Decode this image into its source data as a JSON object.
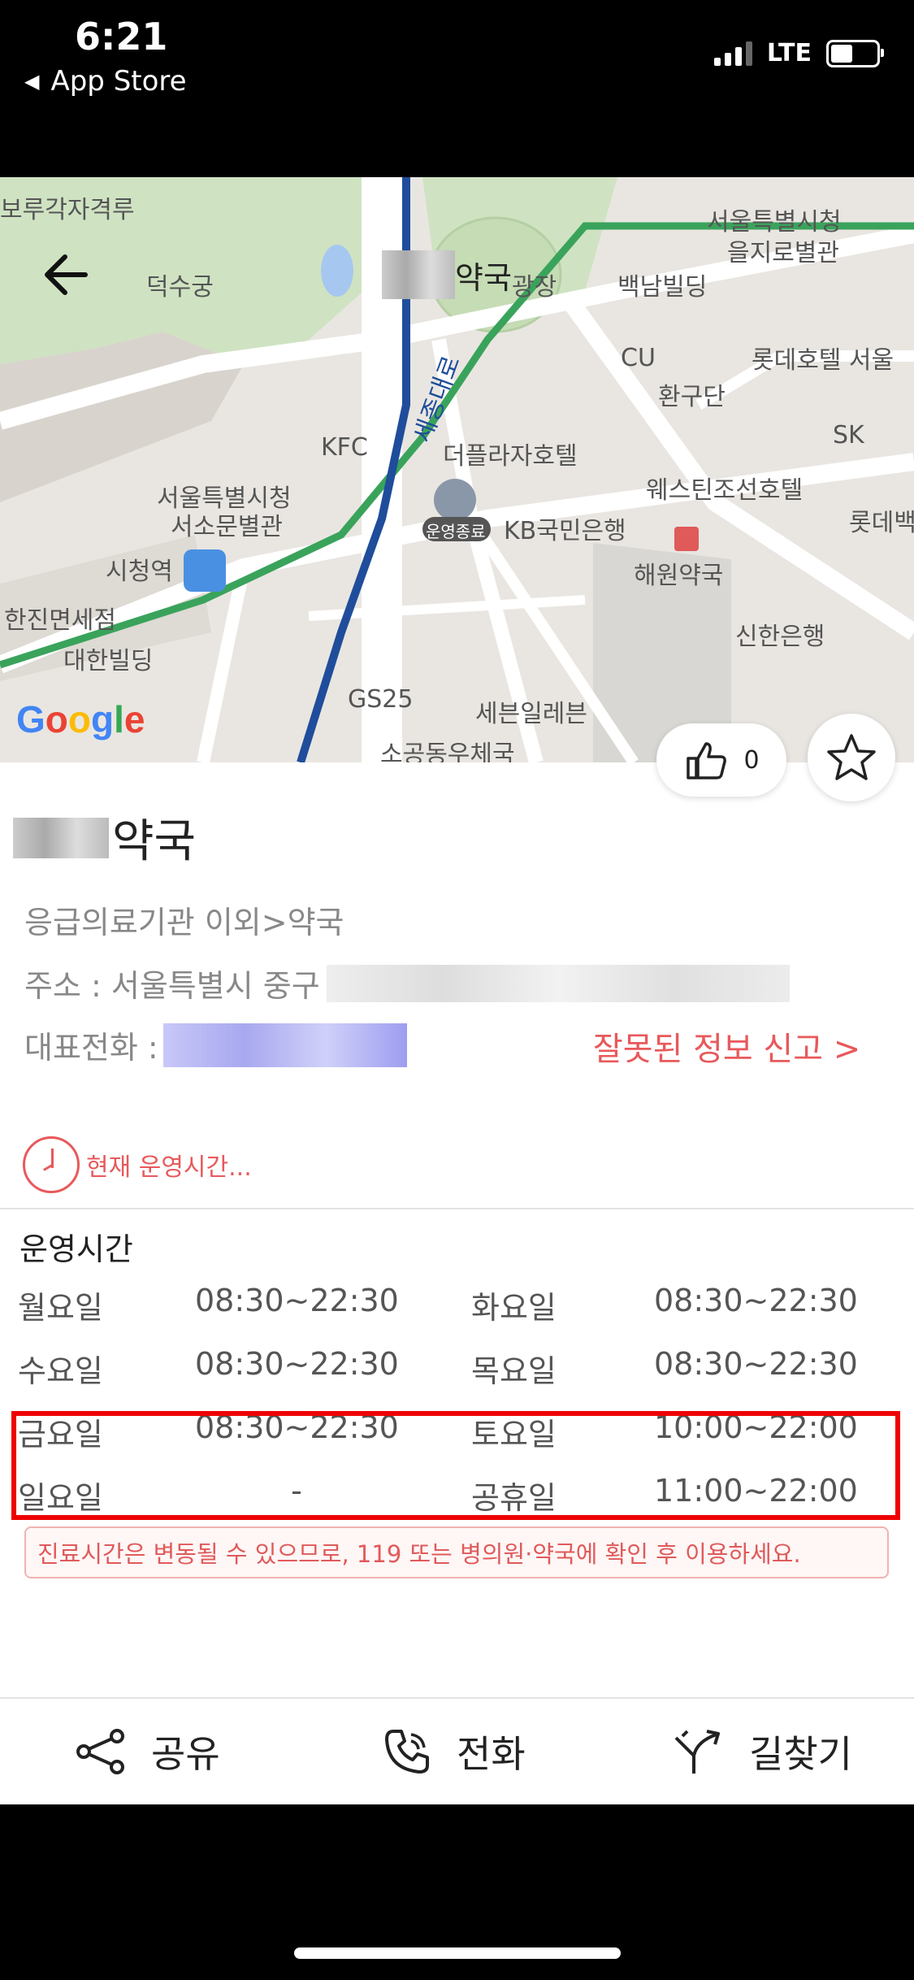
{
  "status_bar": {
    "time": "6:21",
    "back_app": "App Store",
    "network": "LTE"
  },
  "map": {
    "labels": {
      "deoksugung": "덕수궁",
      "boruggak": "보루각자격루",
      "seoul_city_hall_euljiro": "서울특별시청",
      "euljiro_annex": "을지로별관",
      "baeknam": "백남빌딩",
      "cu": "CU",
      "hwangudan": "환구단",
      "lotte_hotel": "롯데호텔 서울",
      "sk": "SK",
      "kfc": "KFC",
      "seoul_city_hall": "서울특별시청",
      "seosomun": "서소문별관",
      "plaza_hotel": "더플라자호텔",
      "westin": "웨스틴조선호텔",
      "lotte_dept": "롯데백",
      "sejong_ro": "세종대로",
      "closed_badge": "운영종료",
      "kb_bank": "KB국민은행",
      "haewon": "해원약국",
      "city_hall_station": "시청역",
      "hanjin": "한진면세점",
      "daehan": "대한빌딩",
      "shinhan": "신한은행",
      "gs25": "GS25",
      "seven_eleven": "세븐일레븐",
      "sogong_post": "소공동우체국",
      "plaza": "광장"
    },
    "title_suffix": "약국",
    "google": [
      "G",
      "o",
      "o",
      "g",
      "l",
      "e"
    ]
  },
  "pharmacy": {
    "name_suffix": "약국",
    "category": "응급의료기관 이외>약국",
    "address_label": "주소 : 서울특별시 중구",
    "phone_label": "대표전화 :",
    "report_link": "잘못된 정보 신고  >",
    "likes": "0",
    "status_now": "현재 운영시간..."
  },
  "hours": {
    "title": "운영시간",
    "rows": [
      {
        "day1": "월요일",
        "time1": "08:30~22:30",
        "day2": "화요일",
        "time2": "08:30~22:30"
      },
      {
        "day1": "수요일",
        "time1": "08:30~22:30",
        "day2": "목요일",
        "time2": "08:30~22:30"
      },
      {
        "day1": "금요일",
        "time1": "08:30~22:30",
        "day2": "토요일",
        "time2": "10:00~22:00"
      },
      {
        "day1": "일요일",
        "time1": "-",
        "day2": "공휴일",
        "time2": "11:00~22:00"
      }
    ],
    "notice": "진료시간은 변동될 수 있으므로, 119 또는 병의원·약국에 확인 후 이용하세요."
  },
  "actions": {
    "share": "공유",
    "call": "전화",
    "directions": "길찾기"
  },
  "colors": {
    "accent_red": "#e8595b",
    "highlight_red": "#ee0000",
    "subway_green": "#3aa35b",
    "subway_blue": "#1f4d9b"
  }
}
